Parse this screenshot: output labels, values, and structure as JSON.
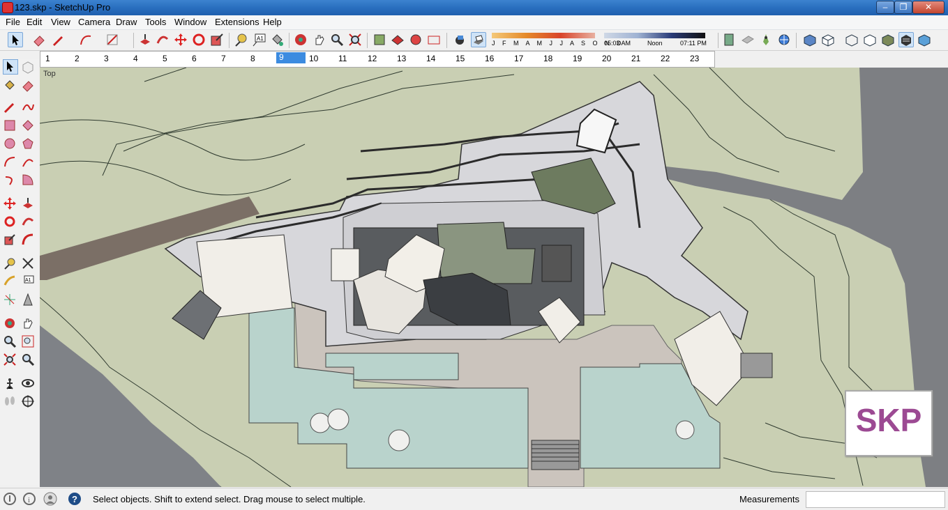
{
  "window": {
    "title": "123.skp - SketchUp Pro"
  },
  "menu": [
    "File",
    "Edit",
    "View",
    "Camera",
    "Draw",
    "Tools",
    "Window",
    "Extensions",
    "Help"
  ],
  "shadows": {
    "months": "J F M A M J J A S O N D",
    "time_start": "05:03 AM",
    "time_mid": "Noon",
    "time_end": "07:11 PM"
  },
  "ruler": {
    "ticks": [
      "1",
      "2",
      "3",
      "4",
      "5",
      "6",
      "7",
      "8",
      "9",
      "10",
      "11",
      "12",
      "13",
      "14",
      "15",
      "16",
      "17",
      "18",
      "19",
      "20",
      "21",
      "22",
      "23"
    ],
    "selected": "9"
  },
  "viewport": {
    "scene_label": "Top",
    "logo_text": "SKP"
  },
  "status": {
    "message": "Select objects. Shift to extend select. Drag mouse to select multiple.",
    "measurements_label": "Measurements",
    "measurements_value": ""
  },
  "colors": {
    "terrain": "#c9cfb3",
    "pool": "#b8d4cc",
    "paving": "#cfc9c4",
    "building": "#d6d6da",
    "road": "#8a8a8a",
    "logo": "#9c4a93"
  }
}
